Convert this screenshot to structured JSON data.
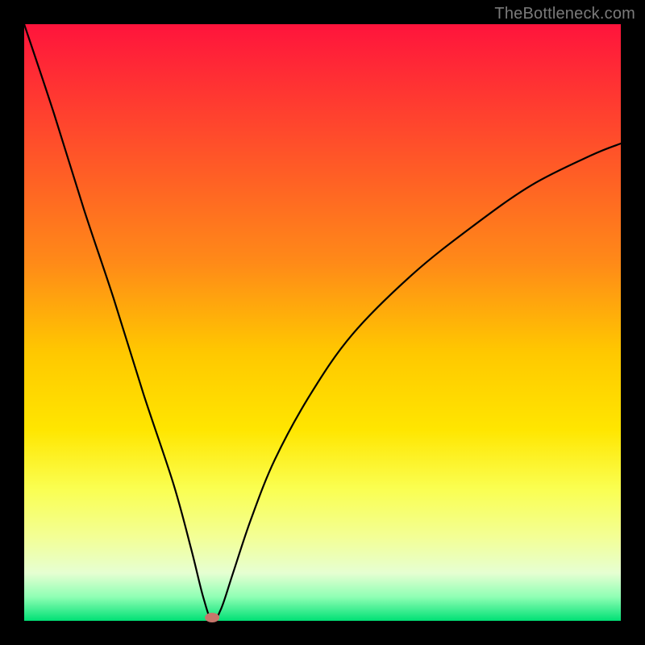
{
  "attribution": "TheBottleneck.com",
  "chart_data": {
    "type": "line",
    "title": "",
    "xlabel": "",
    "ylabel": "",
    "xlim": [
      0,
      100
    ],
    "ylim": [
      0,
      100
    ],
    "series": [
      {
        "name": "bottleneck-curve",
        "x": [
          0,
          5,
          10,
          15,
          20,
          25,
          28,
          30,
          31.5,
          33,
          35,
          38,
          42,
          48,
          55,
          65,
          75,
          85,
          95,
          100
        ],
        "values": [
          100,
          85,
          69,
          54,
          38,
          23,
          12,
          4,
          0,
          2,
          8,
          17,
          27,
          38,
          48,
          58,
          66,
          73,
          78,
          80
        ]
      }
    ],
    "optimum_point": {
      "x": 31.5,
      "y": 0
    },
    "gradient_stops": [
      {
        "offset": 0,
        "color": "#ff143c"
      },
      {
        "offset": 20,
        "color": "#ff4f2a"
      },
      {
        "offset": 40,
        "color": "#ff8a18"
      },
      {
        "offset": 55,
        "color": "#ffc800"
      },
      {
        "offset": 68,
        "color": "#ffe600"
      },
      {
        "offset": 78,
        "color": "#faff52"
      },
      {
        "offset": 86,
        "color": "#f3ff96"
      },
      {
        "offset": 92,
        "color": "#e6ffd2"
      },
      {
        "offset": 96,
        "color": "#8fffb4"
      },
      {
        "offset": 100,
        "color": "#00e075"
      }
    ]
  }
}
